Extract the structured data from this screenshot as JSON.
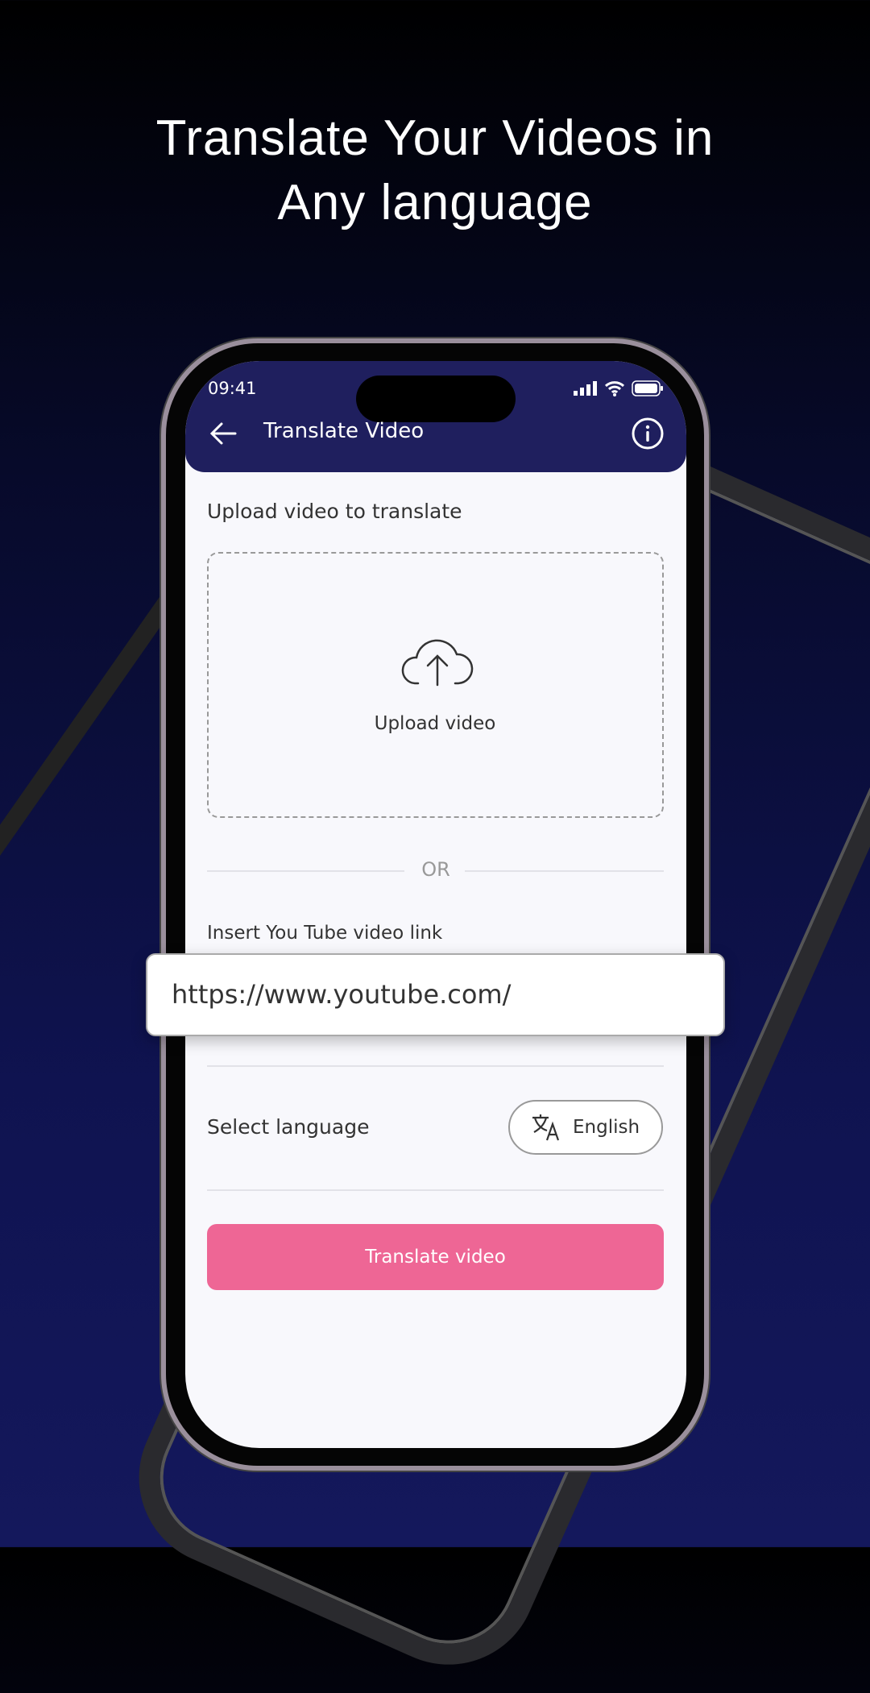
{
  "headline": {
    "line1": "Translate Your Videos in",
    "line2": "Any language"
  },
  "status_bar": {
    "time": "09:41"
  },
  "header": {
    "title": "Translate Video"
  },
  "upload": {
    "section_label": "Upload video to translate",
    "drop_label": "Upload video"
  },
  "or_label": "OR",
  "youtube": {
    "label": "Insert You Tube video link",
    "value": "https://www.youtube.com/"
  },
  "language": {
    "label": "Select language",
    "selected": "English"
  },
  "translate_button": "Translate video",
  "colors": {
    "header": "#1f1f5e",
    "button": "#ee6695"
  }
}
